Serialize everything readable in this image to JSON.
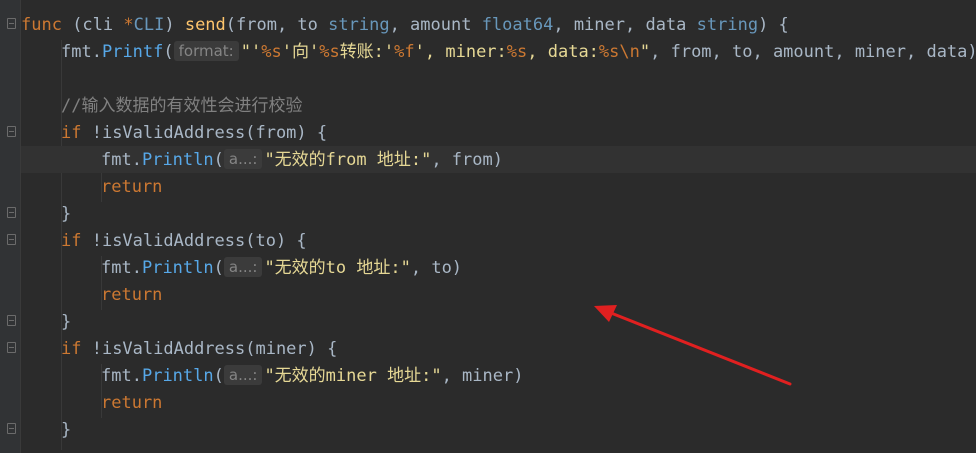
{
  "code": {
    "line1": {
      "kw_func": "func",
      "recv_open": " (cli ",
      "ptr": "*",
      "recv_type": "CLI",
      "recv_close": ") ",
      "fn_name": "send",
      "params_a": "(from, to ",
      "t_string1": "string",
      "params_b": ", amount ",
      "t_float": "float64",
      "params_c": ", miner, data ",
      "t_string2": "string",
      "params_d": ") {"
    },
    "line2": {
      "pkg": "fmt",
      "dot": ".",
      "method": "Printf",
      "open": "(",
      "hint": "format:",
      "s1": "\"'",
      "f1": "%s",
      "s2": "'向'",
      "f2": "%s",
      "s3": "转账:'",
      "f3": "%f",
      "s4": "', miner:",
      "f4": "%s",
      "s5": ", data:",
      "f5": "%s\\n",
      "s6": "\"",
      "args": ", from, to, amount, miner, data)"
    },
    "comment": "//输入数据的有效性会进行校验",
    "if_from": {
      "kw": "if",
      "rest": " !isValidAddress(from) {"
    },
    "print_from": {
      "pkg": "fmt",
      "dot": ".",
      "method": "Println",
      "open": "(",
      "hint": "a...:",
      "str": "\"无效的from 地址:\"",
      "args": ", from)"
    },
    "return1": "return",
    "close1": "}",
    "if_to": {
      "kw": "if",
      "rest": " !isValidAddress(to) {"
    },
    "print_to": {
      "pkg": "fmt",
      "dot": ".",
      "method": "Println",
      "open": "(",
      "hint": "a...:",
      "str": "\"无效的to 地址:\"",
      "args": ", to)"
    },
    "return2": "return",
    "close2": "}",
    "if_miner": {
      "kw": "if",
      "rest": " !isValidAddress(miner) {"
    },
    "print_miner": {
      "pkg": "fmt",
      "dot": ".",
      "method": "Println",
      "open": "(",
      "hint": "a...:",
      "str": "\"无效的miner 地址:\"",
      "args": ", miner)"
    },
    "return3": "return",
    "close3": "}"
  },
  "colors": {
    "background": "#2b2b2b",
    "keyword": "#cc7832",
    "function": "#ffc66d",
    "string": "#6a8759",
    "comment": "#808080",
    "annotation_arrow": "#e02020"
  },
  "icons": [
    "fold-marker-icon",
    "red-arrow-annotation"
  ]
}
